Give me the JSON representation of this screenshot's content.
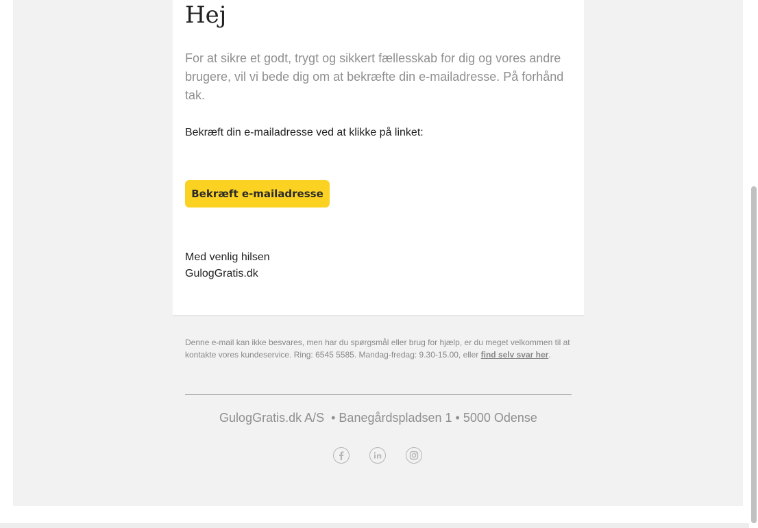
{
  "email": {
    "heading": "Hej",
    "intro": "For at sikre et godt, trygt og sikkert fællesskab for dig og vores andre brugere, vil vi bede dig om at bekræfte din e-mailadresse. På forhånd tak.",
    "instruction": "Bekræft din e-mailadresse ved at klikke på linket:",
    "cta_label": "Bekræft e-mailadresse",
    "signoff_line1": "Med venlig hilsen",
    "signoff_line2": "GulogGratis.dk"
  },
  "footer": {
    "disclaimer_text": "Denne e-mail kan ikke besvares, men har du spørgsmål eller brug for hjælp, er du meget velkommen til at kontakte vores kundeservice. Ring: 6545 5585. Mandag-fredag: 9.30-15.00, eller ",
    "disclaimer_link": "find selv svar her",
    "disclaimer_end": ".",
    "address": "GulogGratis.dk A/S  • Banegårdspladsen 1 • 5000 Odense",
    "social": [
      "facebook-icon",
      "linkedin-icon",
      "instagram-icon"
    ]
  },
  "colors": {
    "accent": "#fcd222",
    "background": "#f2f2f2",
    "muted_text": "#8f8f8f"
  }
}
